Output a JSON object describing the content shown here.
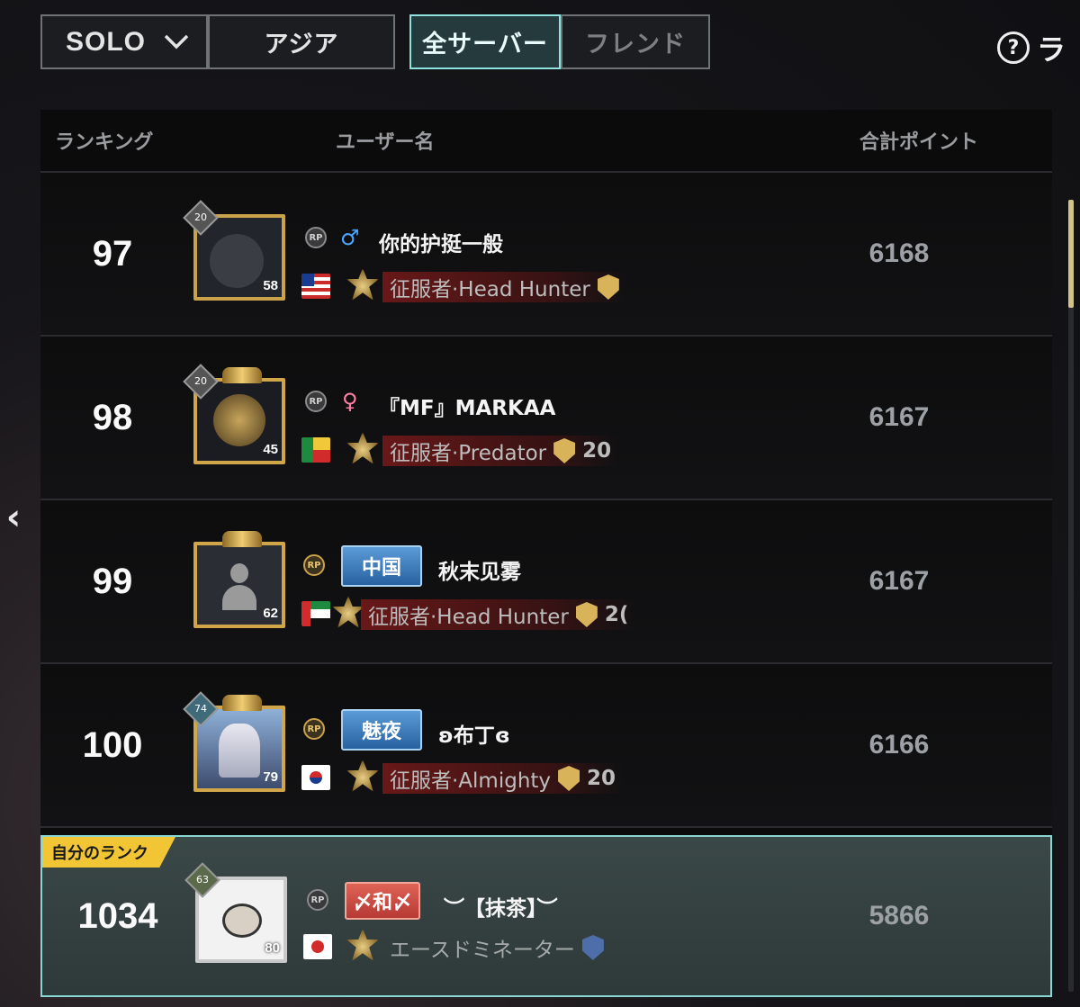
{
  "filters": {
    "mode": "SOLO",
    "mode_dropdown_icon": "chevron-down-icon",
    "region": "アジア",
    "scope_all": "全サーバー",
    "scope_friends": "フレンド"
  },
  "help": {
    "label": "ラ",
    "icon": "question-circle-icon"
  },
  "table": {
    "headers": {
      "rank": "ランキング",
      "user": "ユーザー名",
      "points": "合計ポイント"
    },
    "rows": [
      {
        "rank": "97",
        "avatar_tier": "20",
        "avatar_level": "58",
        "rp_badge": "RP",
        "gender": "♂",
        "name": "你的护挺一般",
        "flag": "Malaysia",
        "title": "征服者·Head Hunter",
        "title_count": "",
        "points": "6168"
      },
      {
        "rank": "98",
        "avatar_tier": "20",
        "avatar_level": "45",
        "rp_badge": "RP",
        "gender": "♀",
        "name": "『MF』MARKAA",
        "flag": "Benin",
        "title": "征服者·Predator",
        "title_count": "20",
        "points": "6167"
      },
      {
        "rank": "99",
        "avatar_tier": "",
        "avatar_level": "62",
        "rp_badge": "RP",
        "team_tag": "中国",
        "name": "秋末见雾",
        "flag": "UAE",
        "title": "征服者·Head Hunter",
        "title_count": "2(",
        "points": "6167"
      },
      {
        "rank": "100",
        "avatar_tier": "74",
        "avatar_level": "79",
        "rp_badge": "RP",
        "team_tag": "魅夜",
        "name": "ʚ布丁ɞ",
        "flag": "South Korea",
        "title": "征服者·Almighty",
        "title_count": "20",
        "points": "6166"
      }
    ],
    "my_rank": {
      "label": "自分のランク",
      "rank": "1034",
      "avatar_tier": "63",
      "avatar_level": "80",
      "rp_badge": "RP",
      "team_tag": "〆和〆",
      "name": "︶【抹茶】︶",
      "flag": "Japan",
      "title": "エースドミネーター",
      "points": "5866"
    }
  },
  "nav": {
    "back_icon": "chevron-left-icon"
  }
}
